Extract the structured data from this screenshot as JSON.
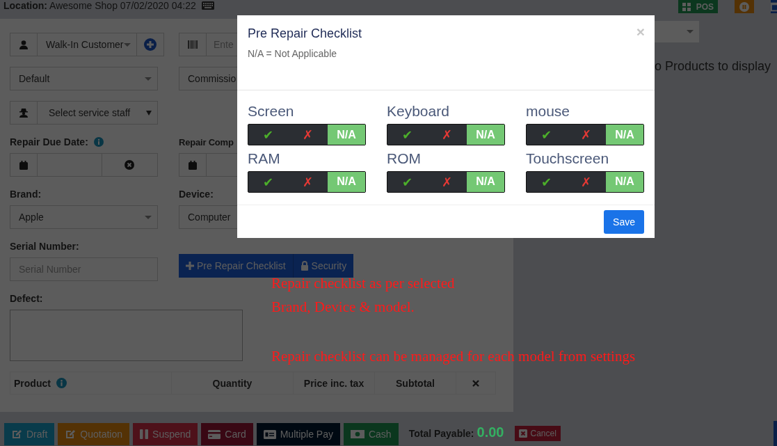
{
  "header": {
    "location_label": "Location:",
    "location_value": "Awesome Shop 07/02/2020 04:22",
    "pos_button": "POS"
  },
  "form": {
    "customer": "Walk-In Customer",
    "barcode_placeholder": "Ente",
    "price_group": "Default",
    "commission": "Commissio",
    "service_staff": "Select service staff",
    "due_date_label": "Repair Due Date:",
    "completed_label": "Repair Comp",
    "brand_label": "Brand:",
    "brand": "Apple",
    "device_label": "Device:",
    "device": "Computer",
    "serial_label": "Serial Number:",
    "serial_placeholder": "Serial Number",
    "checklist_button": "Pre Repair Checklist",
    "security_button": "Security",
    "defect_label": "Defect:"
  },
  "table": {
    "columns": [
      "Product",
      "Quantity",
      "Price inc. tax",
      "Subtotal"
    ]
  },
  "products_message": "o Products to display",
  "footer": {
    "buttons": [
      {
        "label": "Draft",
        "kind": "draft"
      },
      {
        "label": "Quotation",
        "kind": "quotation"
      },
      {
        "label": "Suspend",
        "kind": "suspend"
      },
      {
        "label": "Card",
        "kind": "card"
      },
      {
        "label": "Multiple Pay",
        "kind": "multiple"
      },
      {
        "label": "Cash",
        "kind": "cash"
      }
    ],
    "total_label": "Total Payable:",
    "total": "0.00",
    "cancel": "Cancel"
  },
  "modal": {
    "title": "Pre Repair Checklist",
    "subtitle": "N/A = Not Applicable",
    "close": "×",
    "save": "Save",
    "items": [
      {
        "label": "Screen",
        "options": [
          {
            "label": "✔",
            "kind": "yes",
            "selected": false
          },
          {
            "label": "✗",
            "kind": "no",
            "selected": false
          },
          {
            "label": "N/A",
            "kind": "na",
            "selected": true
          }
        ]
      },
      {
        "label": "Keyboard",
        "options": [
          {
            "label": "✔",
            "kind": "yes",
            "selected": false
          },
          {
            "label": "✗",
            "kind": "no",
            "selected": false
          },
          {
            "label": "N/A",
            "kind": "na",
            "selected": true
          }
        ]
      },
      {
        "label": "mouse",
        "options": [
          {
            "label": "✔",
            "kind": "yes",
            "selected": false
          },
          {
            "label": "✗",
            "kind": "no",
            "selected": false
          },
          {
            "label": "N/A",
            "kind": "na",
            "selected": true
          }
        ]
      },
      {
        "label": "RAM",
        "options": [
          {
            "label": "✔",
            "kind": "yes",
            "selected": false
          },
          {
            "label": "✗",
            "kind": "no",
            "selected": false
          },
          {
            "label": "N/A",
            "kind": "na",
            "selected": true
          }
        ]
      },
      {
        "label": "ROM",
        "options": [
          {
            "label": "✔",
            "kind": "yes",
            "selected": false
          },
          {
            "label": "✗",
            "kind": "no",
            "selected": false
          },
          {
            "label": "N/A",
            "kind": "na",
            "selected": true
          }
        ]
      },
      {
        "label": "Touchscreen",
        "options": [
          {
            "label": "✔",
            "kind": "yes",
            "selected": false
          },
          {
            "label": "✗",
            "kind": "no",
            "selected": false
          },
          {
            "label": "N/A",
            "kind": "na",
            "selected": true
          }
        ]
      }
    ]
  },
  "annotations": [
    "Repair checklist as per selected",
    "Brand, Device & model.",
    "Repair checklist can be managed for each model from settings"
  ]
}
